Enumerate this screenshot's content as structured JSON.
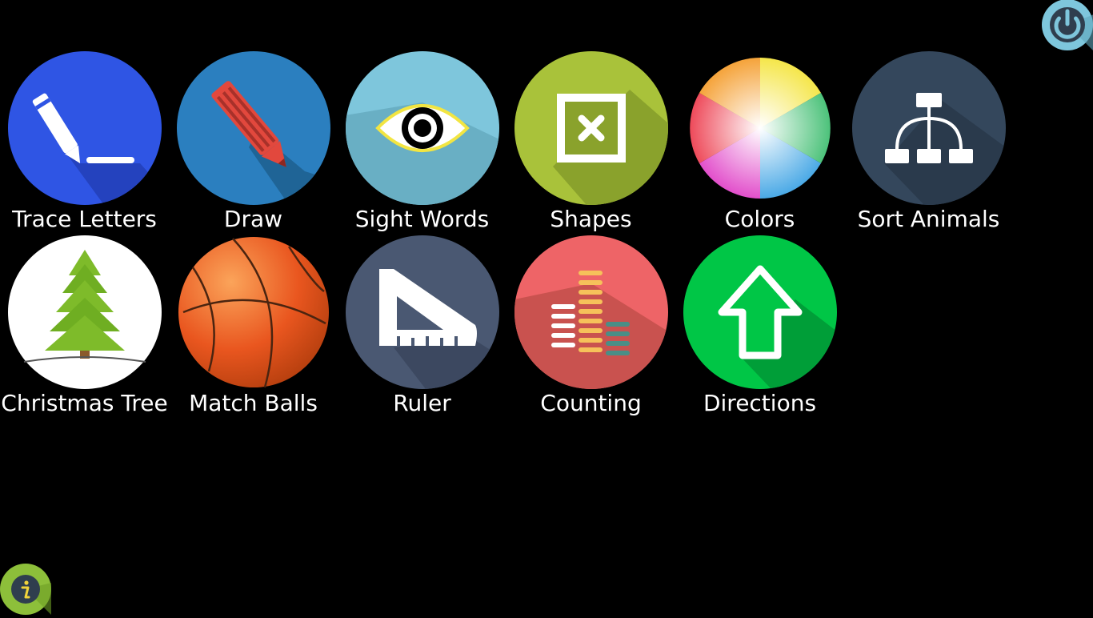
{
  "activities": [
    {
      "label": "Trace Letters",
      "icon": "pencil-line-icon",
      "color": "#2F55E4"
    },
    {
      "label": "Draw",
      "icon": "pencil-icon",
      "color": "#2B7FBF"
    },
    {
      "label": "Sight Words",
      "icon": "eye-icon",
      "color": "#7EC6DC"
    },
    {
      "label": "Shapes",
      "icon": "square-x-icon",
      "color": "#A9C23A"
    },
    {
      "label": "Colors",
      "icon": "color-wheel-icon",
      "color": "#FFFFFF"
    },
    {
      "label": "Sort Animals",
      "icon": "hierarchy-icon",
      "color": "#34475C"
    },
    {
      "label": "Christmas Tree",
      "icon": "christmas-tree-icon",
      "color": "#FFFFFF"
    },
    {
      "label": "Match Balls",
      "icon": "basketball-icon",
      "color": "#E9561F"
    },
    {
      "label": "Ruler",
      "icon": "set-square-ruler-icon",
      "color": "#4A5872"
    },
    {
      "label": "Counting",
      "icon": "bar-stack-icon",
      "color": "#EE6467"
    },
    {
      "label": "Directions",
      "icon": "up-arrow-icon",
      "color": "#00C646"
    }
  ],
  "controls": {
    "power": {
      "icon": "power-icon",
      "color": "#7EC6DC"
    },
    "info": {
      "icon": "info-icon",
      "color": "#8DBF3A"
    }
  }
}
